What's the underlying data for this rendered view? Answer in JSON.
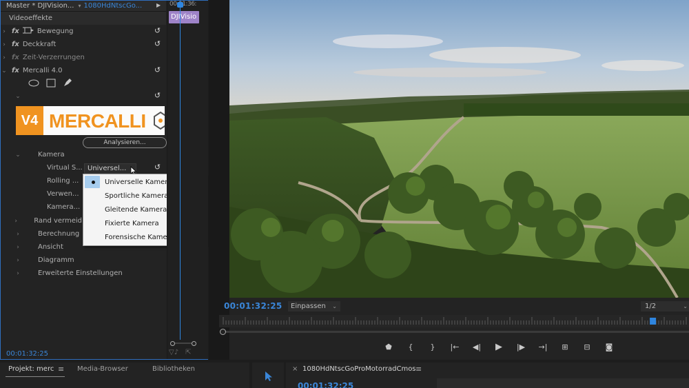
{
  "effect_controls": {
    "master_label": "Master * DJIVision...",
    "clip_label": "1080HdNtscGo...",
    "section_title": "Videoeffekte",
    "effects": [
      {
        "name": "Bewegung",
        "expanded": false
      },
      {
        "name": "Deckkraft",
        "expanded": false
      },
      {
        "name": "Zeit-Verzerrungen",
        "expanded": false
      },
      {
        "name": "Mercalli 4.0",
        "expanded": true
      }
    ],
    "mercalli": {
      "logo_v4": "V4",
      "logo_name": "MERCALLI",
      "analyze_label": "Analysieren...",
      "camera_group": "Kamera",
      "params": [
        {
          "label": "Virtual S..."
        },
        {
          "label": "Rolling ..."
        },
        {
          "label": "Verwen..."
        },
        {
          "label": "Kamera..."
        }
      ],
      "virtual_camera_value": "Universel...",
      "groups": [
        "Rand vermeid",
        "Berechnung",
        "Ansicht",
        "Diagramm",
        "Erweiterte Einstellungen"
      ]
    },
    "camera_dropdown": {
      "options": [
        "Universelle Kamera",
        "Sportliche Kamera",
        "Gleitende Kamera",
        "Fixierte Kamera",
        "Forensische Kamera"
      ],
      "selected_index": 0
    },
    "mini_timeline": {
      "timecode": "00:01:36:",
      "clip_label": "DJIVisio"
    },
    "timecode": "00:01:32:25"
  },
  "program_monitor": {
    "timecode": "00:01:32:25",
    "fit_label": "Einpassen",
    "resolution_label": "1/2",
    "playhead_fraction": 0.93
  },
  "bottom_panels": {
    "project_tab": "Projekt: merc",
    "media_browser_tab": "Media-Browser",
    "libraries_tab": "Bibliotheken",
    "sequence_tab": "1080HdNtscGoProMotorradCmos",
    "sequence_timecode": "00:01:32:25"
  },
  "colors": {
    "accent_blue": "#3a86d8",
    "panel_bg": "#232323",
    "clip_purple": "#9e83c8",
    "mercalli_orange": "#f09320",
    "dropdown_selection": "#a7cdee"
  },
  "icons": [
    "reset-icon",
    "fx-icon",
    "motion-icon",
    "ellipse-mask-icon",
    "rectangle-mask-icon",
    "pen-mask-icon",
    "chevron-icon",
    "mouse-cursor-icon",
    "marker-icon",
    "in-point-icon",
    "out-point-icon",
    "go-to-in-icon",
    "step-back-icon",
    "play-icon",
    "step-forward-icon",
    "go-to-out-icon",
    "insert-icon",
    "overwrite-icon",
    "camera-icon",
    "selection-tool-icon",
    "hamburger-menu-icon"
  ]
}
